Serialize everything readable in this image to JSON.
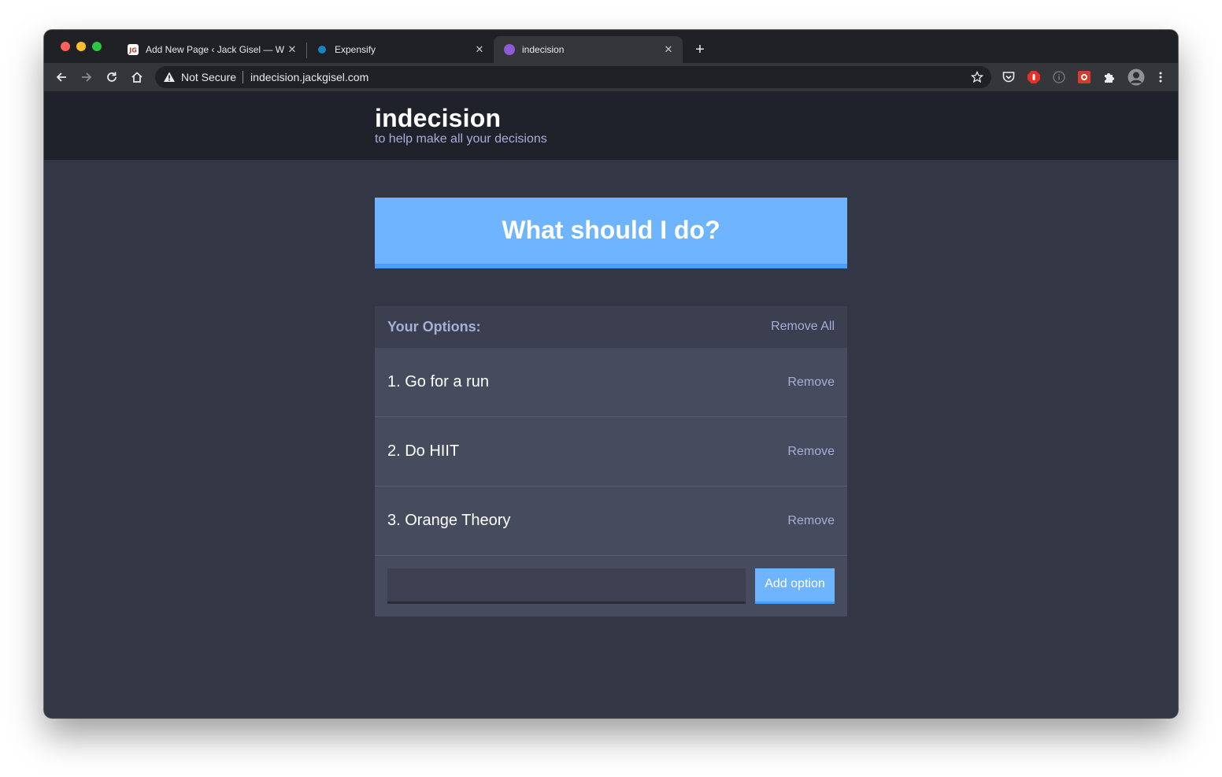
{
  "browser": {
    "tabs": [
      {
        "title": "Add New Page ‹ Jack Gisel — W",
        "favicon": "jg-logo-icon",
        "active": false
      },
      {
        "title": "Expensify",
        "favicon": "expensify-dot-icon",
        "active": false
      },
      {
        "title": "indecision",
        "favicon": "indecision-dot-icon",
        "active": true
      }
    ],
    "security_label": "Not Secure",
    "url": "indecision.jackgisel.com",
    "colors": {
      "tab_strip": "#202124",
      "toolbar": "#35363a",
      "expensify_dot": "#1a82c5",
      "indecision_dot": "#8d5bd6"
    }
  },
  "app": {
    "title": "indecision",
    "subtitle": "to help make all your decisions",
    "primary_button": "What should I do?",
    "widget": {
      "header": "Your Options:",
      "remove_all": "Remove All",
      "options": [
        {
          "text": "1. Go for a run",
          "remove": "Remove"
        },
        {
          "text": "2. Do HIIT",
          "remove": "Remove"
        },
        {
          "text": "3. Orange Theory",
          "remove": "Remove"
        }
      ],
      "input_value": "",
      "add_button": "Add option"
    },
    "colors": {
      "header_bg": "#20222b",
      "page_bg": "#333645",
      "accent": "#6fb4ff",
      "muted_text": "#a5afd7",
      "widget_bg": "#464b5e"
    }
  }
}
